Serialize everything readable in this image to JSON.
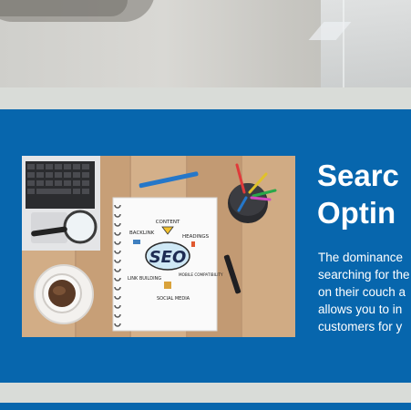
{
  "section": {
    "title_lines": [
      "Searc",
      "Optin"
    ],
    "body_lines": [
      "The dominance",
      "searching for the",
      "on their couch a",
      "allows you to in",
      "customers for y"
    ]
  },
  "illustration": {
    "seo_text": "SEO",
    "labels": [
      "CONTENT",
      "BACKLINK",
      "HEADINGS",
      "LINK BUILDING",
      "MOBILE COMPATIBILITY",
      "SOCIAL MEDIA"
    ]
  },
  "colors": {
    "blue": "#0766ad",
    "band": "#d9dcd8",
    "text": "#ffffff"
  }
}
